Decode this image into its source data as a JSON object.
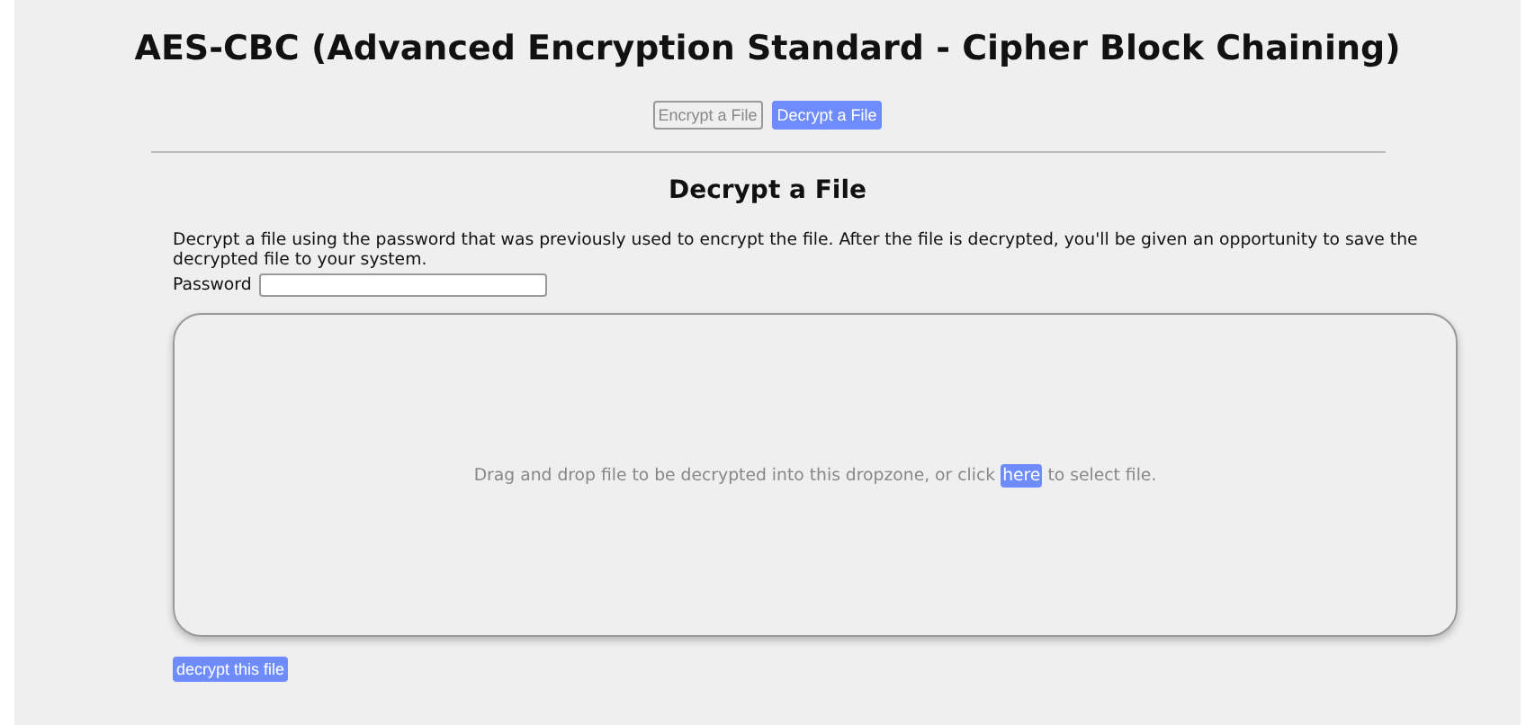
{
  "title": "AES-CBC (Advanced Encryption Standard - Cipher Block Chaining)",
  "tabs": [
    {
      "label": "Encrypt a File",
      "selected": false
    },
    {
      "label": "Decrypt a File",
      "selected": true
    }
  ],
  "section": {
    "heading": "Decrypt a File",
    "description": "Decrypt a file using the password that was previously used to encrypt the file. After the file is decrypted, you'll be given an opportunity to save the decrypted file to your system.",
    "password_label": "Password"
  },
  "dropzone": {
    "text_before": "Drag and drop file to be decrypted into this dropzone, or click",
    "link": "here",
    "text_after": "to select file."
  },
  "submit_button": "decrypt this file"
}
